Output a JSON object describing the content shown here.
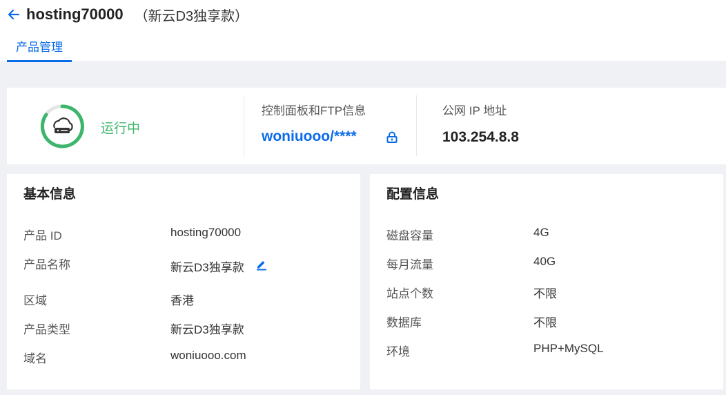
{
  "header": {
    "title": "hosting70000",
    "subtitle": "（新云D3独享款）",
    "tab": "产品管理"
  },
  "status": {
    "text": "运行中",
    "ftp_label": "控制面板和FTP信息",
    "ftp_value": "woniuooo/****",
    "ip_label": "公网 IP 地址",
    "ip_value": "103.254.8.8"
  },
  "basic": {
    "title": "基本信息",
    "rows": [
      {
        "label": "产品 ID",
        "value": "hosting70000"
      },
      {
        "label": "产品名称",
        "value": "新云D3独享款"
      },
      {
        "label": "区域",
        "value": "香港"
      },
      {
        "label": "产品类型",
        "value": "新云D3独享款"
      },
      {
        "label": "域名",
        "value": "woniuooo.com"
      }
    ]
  },
  "config": {
    "title": "配置信息",
    "rows": [
      {
        "label": "磁盘容量",
        "value": "4G"
      },
      {
        "label": "每月流量",
        "value": "40G"
      },
      {
        "label": "站点个数",
        "value": "不限"
      },
      {
        "label": "数据库",
        "value": "不限"
      },
      {
        "label": "环境",
        "value": "PHP+MySQL"
      }
    ]
  },
  "colors": {
    "accent": "#0a6bea",
    "running": "#3bb66a",
    "background": "#f0f1f5"
  }
}
